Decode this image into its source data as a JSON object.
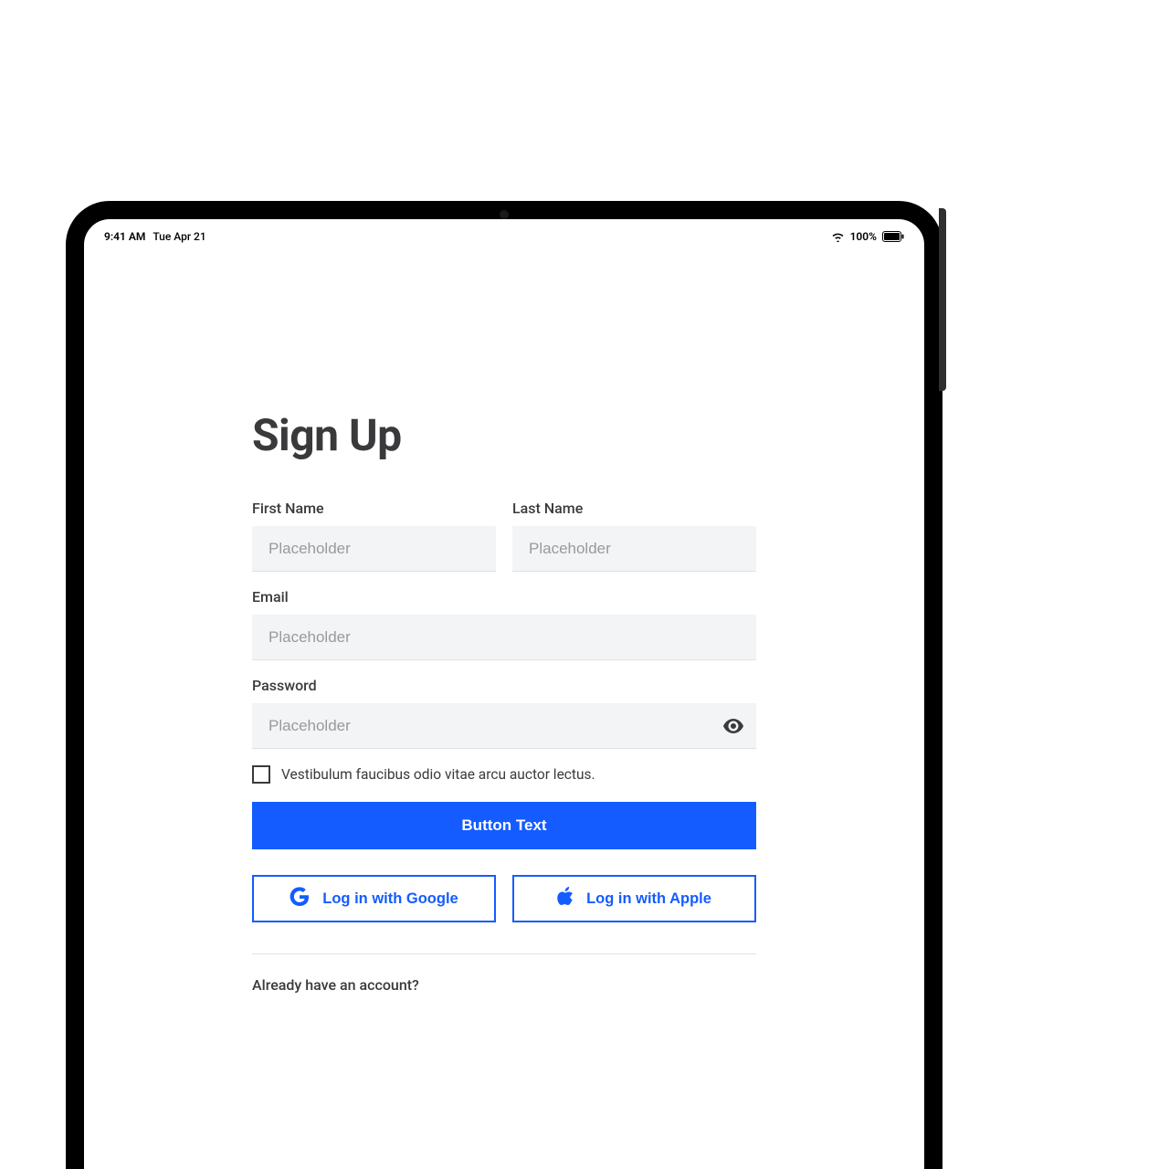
{
  "status_bar": {
    "time": "9:41 AM",
    "date": "Tue Apr 21",
    "battery_pct": "100%"
  },
  "form": {
    "title": "Sign Up",
    "first_name": {
      "label": "First Name",
      "placeholder": "Placeholder"
    },
    "last_name": {
      "label": "Last Name",
      "placeholder": "Placeholder"
    },
    "email": {
      "label": "Email",
      "placeholder": "Placeholder"
    },
    "password": {
      "label": "Password",
      "placeholder": "Placeholder"
    },
    "terms_text": "Vestibulum faucibus odio vitae arcu auctor lectus.",
    "submit_label": "Button Text",
    "google_label": "Log in with Google",
    "apple_label": "Log in with Apple",
    "already_text": "Already have an account?"
  },
  "colors": {
    "primary": "#145cff",
    "text": "#3a3a3c",
    "input_bg": "#f3f4f5",
    "placeholder": "#9a9a9a"
  }
}
